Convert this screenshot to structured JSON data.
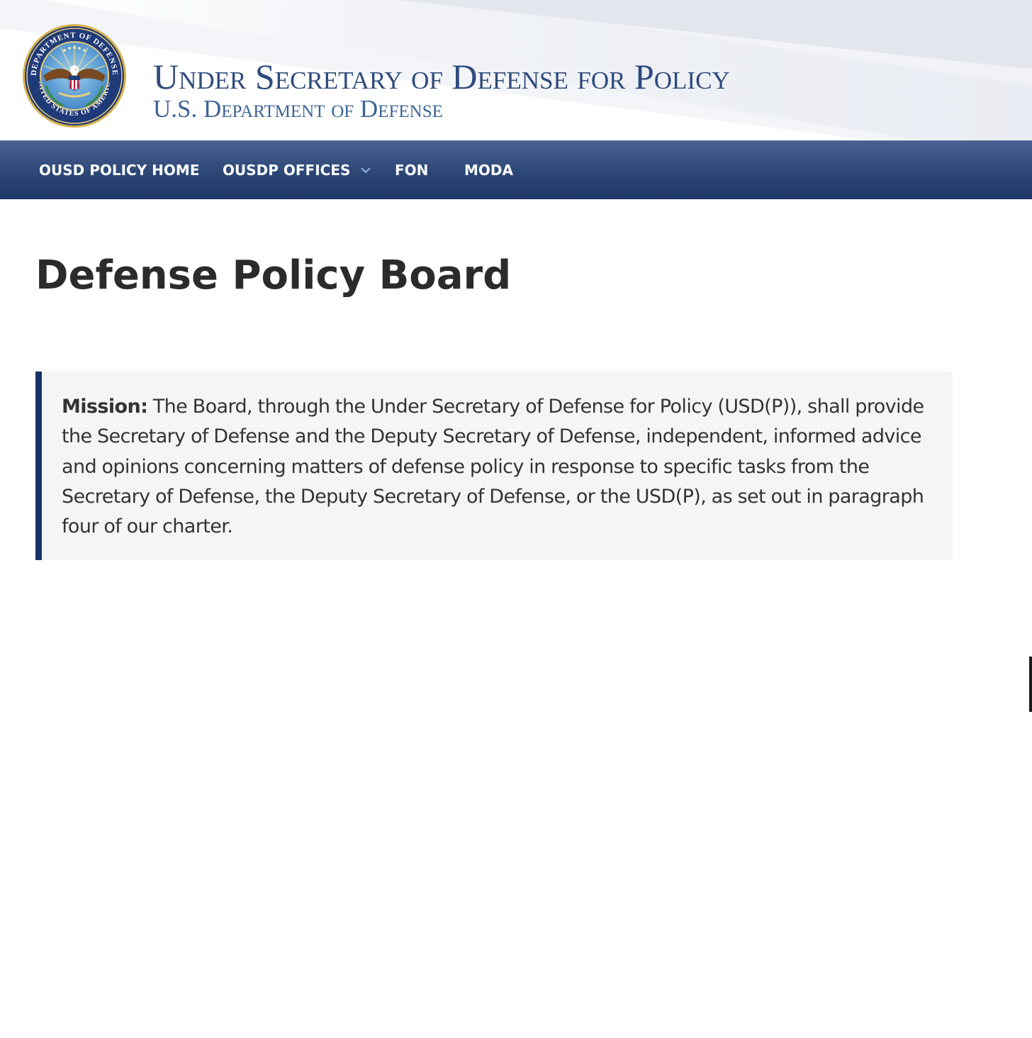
{
  "header": {
    "seal_label": "DoD seal",
    "seal_ring_top": "DEPARTMENT OF DEFENSE",
    "seal_ring_bottom": "UNITED STATES OF AMERICA",
    "title": "Under Secretary of Defense for Policy",
    "subtitle": "U.S. Department of Defense"
  },
  "nav": {
    "items": [
      {
        "label": "OUSD POLICY HOME"
      },
      {
        "label": "OUSDP OFFICES",
        "icon": "chevron-down-icon"
      },
      {
        "label": "FON"
      },
      {
        "label": "MODA"
      }
    ]
  },
  "main": {
    "title": "Defense Policy Board",
    "mission": {
      "label": "Mission:",
      "text": " The Board, through the Under Secretary of Defense for Policy (USD(P)), shall provide the Secretary of Defense and the Deputy Secretary of Defense, independent, informed advice and opinions concerning matters of defense policy in response to specific tasks from the Secretary of Defense, the Deputy Secretary of Defense, or the USD(P), as set out in paragraph four of our charter."
    }
  },
  "colors": {
    "brand_blue": "#2f4b7c",
    "nav_dark": "#1e3766",
    "accent_border": "#1b3466",
    "mission_bg": "#f5f5f5"
  }
}
